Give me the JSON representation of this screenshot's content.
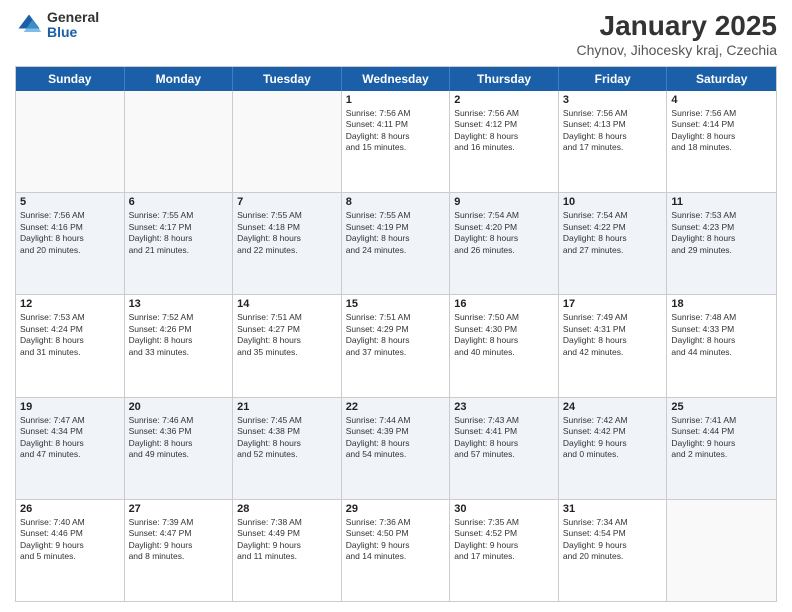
{
  "logo": {
    "general": "General",
    "blue": "Blue"
  },
  "title": "January 2025",
  "subtitle": "Chynov, Jihocesky kraj, Czechia",
  "headers": [
    "Sunday",
    "Monday",
    "Tuesday",
    "Wednesday",
    "Thursday",
    "Friday",
    "Saturday"
  ],
  "weeks": [
    [
      {
        "day": "",
        "text": ""
      },
      {
        "day": "",
        "text": ""
      },
      {
        "day": "",
        "text": ""
      },
      {
        "day": "1",
        "text": "Sunrise: 7:56 AM\nSunset: 4:11 PM\nDaylight: 8 hours\nand 15 minutes."
      },
      {
        "day": "2",
        "text": "Sunrise: 7:56 AM\nSunset: 4:12 PM\nDaylight: 8 hours\nand 16 minutes."
      },
      {
        "day": "3",
        "text": "Sunrise: 7:56 AM\nSunset: 4:13 PM\nDaylight: 8 hours\nand 17 minutes."
      },
      {
        "day": "4",
        "text": "Sunrise: 7:56 AM\nSunset: 4:14 PM\nDaylight: 8 hours\nand 18 minutes."
      }
    ],
    [
      {
        "day": "5",
        "text": "Sunrise: 7:56 AM\nSunset: 4:16 PM\nDaylight: 8 hours\nand 20 minutes."
      },
      {
        "day": "6",
        "text": "Sunrise: 7:55 AM\nSunset: 4:17 PM\nDaylight: 8 hours\nand 21 minutes."
      },
      {
        "day": "7",
        "text": "Sunrise: 7:55 AM\nSunset: 4:18 PM\nDaylight: 8 hours\nand 22 minutes."
      },
      {
        "day": "8",
        "text": "Sunrise: 7:55 AM\nSunset: 4:19 PM\nDaylight: 8 hours\nand 24 minutes."
      },
      {
        "day": "9",
        "text": "Sunrise: 7:54 AM\nSunset: 4:20 PM\nDaylight: 8 hours\nand 26 minutes."
      },
      {
        "day": "10",
        "text": "Sunrise: 7:54 AM\nSunset: 4:22 PM\nDaylight: 8 hours\nand 27 minutes."
      },
      {
        "day": "11",
        "text": "Sunrise: 7:53 AM\nSunset: 4:23 PM\nDaylight: 8 hours\nand 29 minutes."
      }
    ],
    [
      {
        "day": "12",
        "text": "Sunrise: 7:53 AM\nSunset: 4:24 PM\nDaylight: 8 hours\nand 31 minutes."
      },
      {
        "day": "13",
        "text": "Sunrise: 7:52 AM\nSunset: 4:26 PM\nDaylight: 8 hours\nand 33 minutes."
      },
      {
        "day": "14",
        "text": "Sunrise: 7:51 AM\nSunset: 4:27 PM\nDaylight: 8 hours\nand 35 minutes."
      },
      {
        "day": "15",
        "text": "Sunrise: 7:51 AM\nSunset: 4:29 PM\nDaylight: 8 hours\nand 37 minutes."
      },
      {
        "day": "16",
        "text": "Sunrise: 7:50 AM\nSunset: 4:30 PM\nDaylight: 8 hours\nand 40 minutes."
      },
      {
        "day": "17",
        "text": "Sunrise: 7:49 AM\nSunset: 4:31 PM\nDaylight: 8 hours\nand 42 minutes."
      },
      {
        "day": "18",
        "text": "Sunrise: 7:48 AM\nSunset: 4:33 PM\nDaylight: 8 hours\nand 44 minutes."
      }
    ],
    [
      {
        "day": "19",
        "text": "Sunrise: 7:47 AM\nSunset: 4:34 PM\nDaylight: 8 hours\nand 47 minutes."
      },
      {
        "day": "20",
        "text": "Sunrise: 7:46 AM\nSunset: 4:36 PM\nDaylight: 8 hours\nand 49 minutes."
      },
      {
        "day": "21",
        "text": "Sunrise: 7:45 AM\nSunset: 4:38 PM\nDaylight: 8 hours\nand 52 minutes."
      },
      {
        "day": "22",
        "text": "Sunrise: 7:44 AM\nSunset: 4:39 PM\nDaylight: 8 hours\nand 54 minutes."
      },
      {
        "day": "23",
        "text": "Sunrise: 7:43 AM\nSunset: 4:41 PM\nDaylight: 8 hours\nand 57 minutes."
      },
      {
        "day": "24",
        "text": "Sunrise: 7:42 AM\nSunset: 4:42 PM\nDaylight: 9 hours\nand 0 minutes."
      },
      {
        "day": "25",
        "text": "Sunrise: 7:41 AM\nSunset: 4:44 PM\nDaylight: 9 hours\nand 2 minutes."
      }
    ],
    [
      {
        "day": "26",
        "text": "Sunrise: 7:40 AM\nSunset: 4:46 PM\nDaylight: 9 hours\nand 5 minutes."
      },
      {
        "day": "27",
        "text": "Sunrise: 7:39 AM\nSunset: 4:47 PM\nDaylight: 9 hours\nand 8 minutes."
      },
      {
        "day": "28",
        "text": "Sunrise: 7:38 AM\nSunset: 4:49 PM\nDaylight: 9 hours\nand 11 minutes."
      },
      {
        "day": "29",
        "text": "Sunrise: 7:36 AM\nSunset: 4:50 PM\nDaylight: 9 hours\nand 14 minutes."
      },
      {
        "day": "30",
        "text": "Sunrise: 7:35 AM\nSunset: 4:52 PM\nDaylight: 9 hours\nand 17 minutes."
      },
      {
        "day": "31",
        "text": "Sunrise: 7:34 AM\nSunset: 4:54 PM\nDaylight: 9 hours\nand 20 minutes."
      },
      {
        "day": "",
        "text": ""
      }
    ]
  ]
}
